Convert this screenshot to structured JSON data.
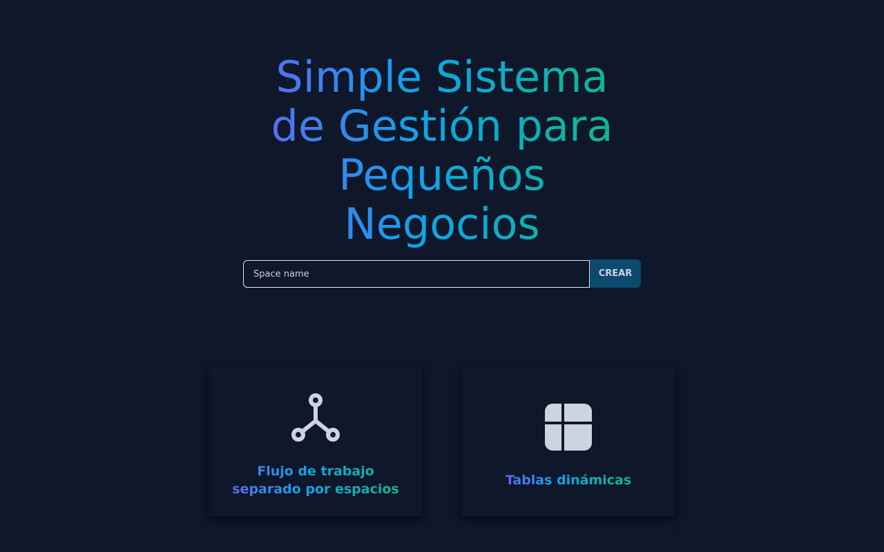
{
  "hero": {
    "title": "Simple Sistema de Gestión para Pequeños Negocios"
  },
  "space_form": {
    "input_value": "",
    "input_placeholder": "Space name",
    "create_label": "CREAR"
  },
  "features": [
    {
      "label": "Flujo de trabajo separado por espacios",
      "icon": "workflow-icon"
    },
    {
      "label": "Tablas dinámicas",
      "icon": "table-layout-icon"
    }
  ],
  "colors": {
    "background": "#0f172a",
    "gradient_start": "#6366f1",
    "gradient_mid": "#0ea5e9",
    "gradient_end": "#10b981",
    "button_bg": "#0c4a6e",
    "icon": "#cbd5e1"
  }
}
